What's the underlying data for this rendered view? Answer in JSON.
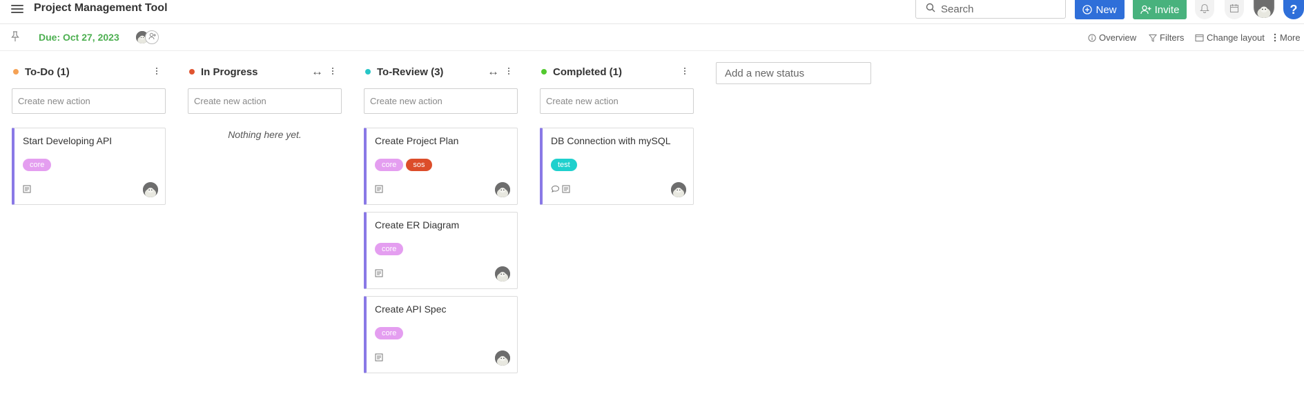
{
  "app": {
    "title": "Project Management Tool"
  },
  "header": {
    "search_placeholder": "Search",
    "new_label": "New",
    "invite_label": "Invite",
    "help_label": "?"
  },
  "subbar": {
    "due_label": "Due: Oct 27, 2023",
    "overview_label": "Overview",
    "filters_label": "Filters",
    "change_layout_label": "Change layout",
    "more_label": "More"
  },
  "colors": {
    "primary": "#2f6fd9",
    "invite": "#48b27d",
    "due": "#4caf50",
    "card_accent": "#8a79e6",
    "tag_core": "#e49ef0",
    "tag_sos": "#dc4d2a",
    "tag_test": "#1fd0cd"
  },
  "columns": [
    {
      "title": "To-Do (1)",
      "dot_color": "#f5a255",
      "has_expand": false,
      "placeholder": "Create new action",
      "empty_text": "",
      "cards": [
        {
          "title": "Start Developing API",
          "tags": [
            {
              "label": "core",
              "color": "#e49ef0"
            }
          ],
          "has_comment": false
        }
      ]
    },
    {
      "title": "In Progress",
      "dot_color": "#e05430",
      "has_expand": true,
      "placeholder": "Create new action",
      "empty_text": "Nothing here yet.",
      "cards": []
    },
    {
      "title": "To-Review (3)",
      "dot_color": "#27c6c7",
      "has_expand": true,
      "placeholder": "Create new action",
      "empty_text": "",
      "cards": [
        {
          "title": "Create Project Plan",
          "tags": [
            {
              "label": "core",
              "color": "#e49ef0"
            },
            {
              "label": "sos",
              "color": "#dc4d2a"
            }
          ],
          "has_comment": false
        },
        {
          "title": "Create ER Diagram",
          "tags": [
            {
              "label": "core",
              "color": "#e49ef0"
            }
          ],
          "has_comment": false
        },
        {
          "title": "Create API Spec",
          "tags": [
            {
              "label": "core",
              "color": "#e49ef0"
            }
          ],
          "has_comment": false
        }
      ]
    },
    {
      "title": "Completed (1)",
      "dot_color": "#53c92f",
      "has_expand": false,
      "placeholder": "Create new action",
      "empty_text": "",
      "cards": [
        {
          "title": "DB Connection with mySQL",
          "tags": [
            {
              "label": "test",
              "color": "#1fd0cd"
            }
          ],
          "has_comment": true
        }
      ]
    }
  ],
  "add_status_placeholder": "Add a new status"
}
